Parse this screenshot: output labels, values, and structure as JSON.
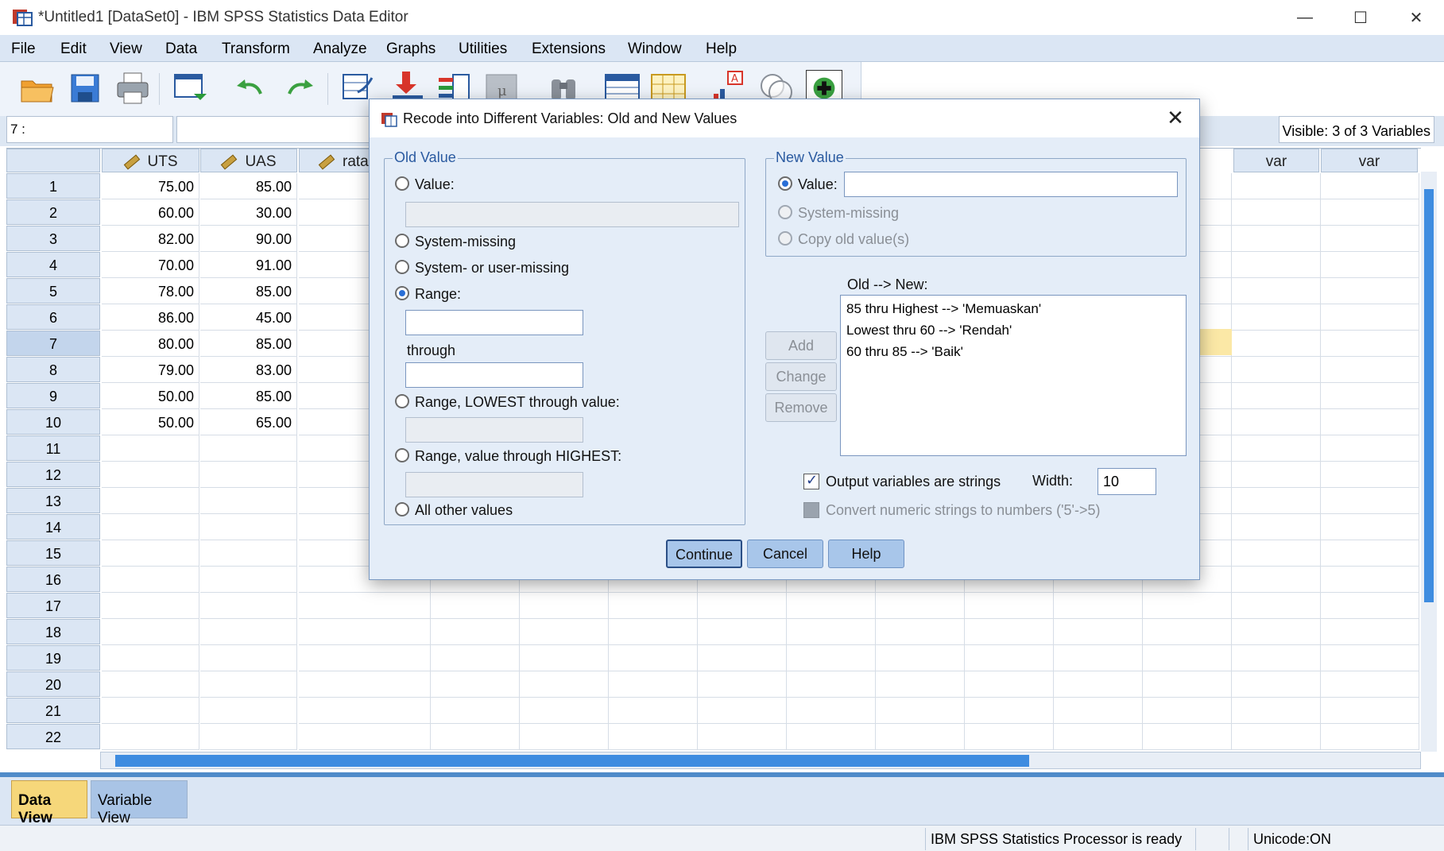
{
  "window": {
    "title": "*Untitled1 [DataSet0] - IBM SPSS Statistics Data Editor",
    "minimize": "—",
    "maximize": "☐",
    "close": "✕"
  },
  "menu": [
    "File",
    "Edit",
    "View",
    "Data",
    "Transform",
    "Analyze",
    "Graphs",
    "Utilities",
    "Extensions",
    "Window",
    "Help"
  ],
  "toolbar_icons": [
    "open-icon",
    "save-icon",
    "print-icon",
    "recall-dialog-icon",
    "undo-icon",
    "redo-icon",
    "goto-case-icon",
    "goto-variable-icon",
    "variables-icon",
    "run-descriptives-icon",
    "find-icon",
    "insert-cases-icon",
    "insert-variable-icon",
    "split-file-icon",
    "select-cases-icon",
    "value-labels-icon",
    "use-sets-icon"
  ],
  "refrow": {
    "cell_ref": "7 :",
    "visible": "Visible: 3 of 3 Variables"
  },
  "grid": {
    "columns": [
      {
        "name": "UTS",
        "numeric": true
      },
      {
        "name": "UAS",
        "numeric": true
      },
      {
        "name": "rata",
        "numeric": true
      },
      {
        "name": "var",
        "numeric": false
      },
      {
        "name": "var",
        "numeric": false
      }
    ],
    "rows": [
      {
        "n": "1",
        "uts": "75.00",
        "uas": "85.00"
      },
      {
        "n": "2",
        "uts": "60.00",
        "uas": "30.00"
      },
      {
        "n": "3",
        "uts": "82.00",
        "uas": "90.00"
      },
      {
        "n": "4",
        "uts": "70.00",
        "uas": "91.00"
      },
      {
        "n": "5",
        "uts": "78.00",
        "uas": "85.00"
      },
      {
        "n": "6",
        "uts": "86.00",
        "uas": "45.00"
      },
      {
        "n": "7",
        "uts": "80.00",
        "uas": "85.00"
      },
      {
        "n": "8",
        "uts": "79.00",
        "uas": "83.00"
      },
      {
        "n": "9",
        "uts": "50.00",
        "uas": "85.00"
      },
      {
        "n": "10",
        "uts": "50.00",
        "uas": "65.00"
      },
      {
        "n": "11",
        "uts": "",
        "uas": ""
      },
      {
        "n": "12",
        "uts": "",
        "uas": ""
      },
      {
        "n": "13",
        "uts": "",
        "uas": ""
      },
      {
        "n": "14",
        "uts": "",
        "uas": ""
      },
      {
        "n": "15",
        "uts": "",
        "uas": ""
      },
      {
        "n": "16",
        "uts": "",
        "uas": ""
      },
      {
        "n": "17",
        "uts": "",
        "uas": ""
      },
      {
        "n": "18",
        "uts": "",
        "uas": ""
      },
      {
        "n": "19",
        "uts": "",
        "uas": ""
      },
      {
        "n": "20",
        "uts": "",
        "uas": ""
      },
      {
        "n": "21",
        "uts": "",
        "uas": ""
      },
      {
        "n": "22",
        "uts": "",
        "uas": ""
      }
    ]
  },
  "tabs": {
    "data_view": "Data View",
    "variable_view": "Variable View"
  },
  "status": {
    "processor": "IBM SPSS Statistics Processor is ready",
    "unicode": "Unicode:ON"
  },
  "dialog": {
    "title": "Recode into Different Variables: Old and New Values",
    "old_value": {
      "legend": "Old Value",
      "value_label": "Value:",
      "system_missing": "System-missing",
      "system_or_user_missing": "System- or user-missing",
      "range_label": "Range:",
      "through": "through",
      "range_lowest": "Range, LOWEST through value:",
      "range_highest": "Range, value through HIGHEST:",
      "all_other": "All other values",
      "selected": "range"
    },
    "new_value": {
      "legend": "New Value",
      "value_label": "Value:",
      "value_input": "",
      "system_missing": "System-missing",
      "copy_old": "Copy old value(s)"
    },
    "mapping": {
      "label": "Old --> New:",
      "items": [
        "85 thru Highest --> 'Memuaskan'",
        "Lowest thru 60 --> 'Rendah'",
        "60 thru 85 --> 'Baik'"
      ]
    },
    "buttons": {
      "add": "Add",
      "change": "Change",
      "remove": "Remove",
      "continue": "Continue",
      "cancel": "Cancel",
      "help": "Help"
    },
    "output_strings": {
      "label": "Output variables are strings",
      "checked": true,
      "width_label": "Width:",
      "width_value": "10"
    },
    "convert_numeric": {
      "label": "Convert numeric strings to numbers ('5'->5)",
      "checked": false
    }
  },
  "colors": {
    "accent": "#3e8ce0",
    "menubar": "#dbe6f4",
    "dialog_bg": "#e4edf8",
    "active_tab": "#f6d77a",
    "highlight_cell": "#fbe8a6"
  }
}
